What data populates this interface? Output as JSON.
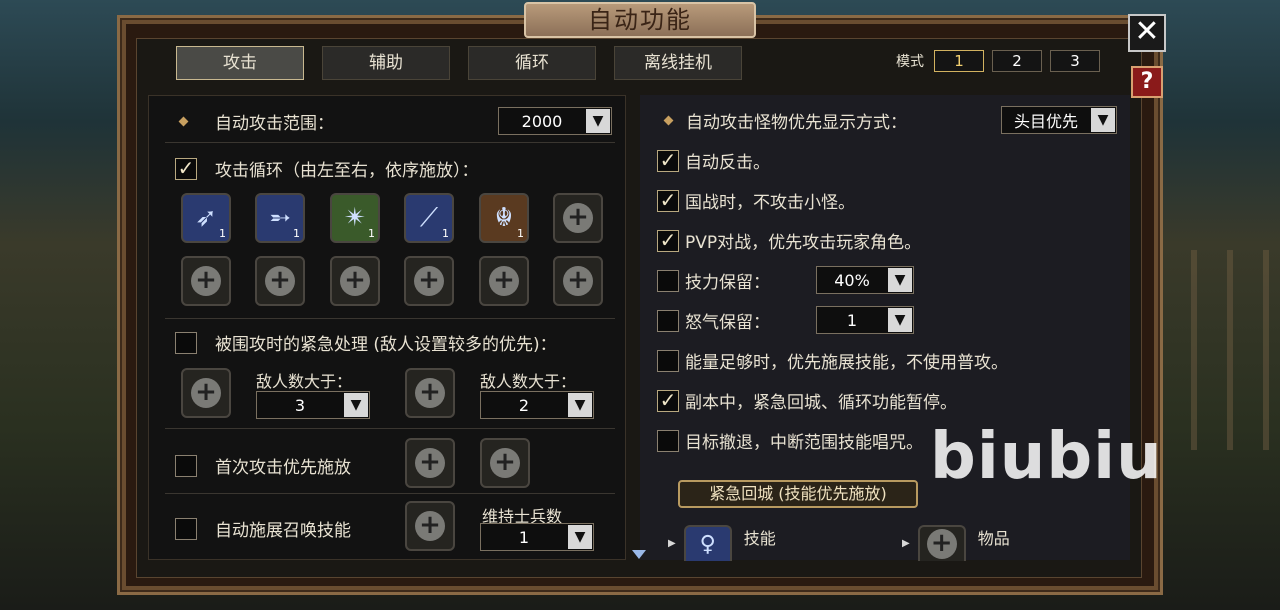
{
  "title": "自动功能",
  "close_icon": "✕",
  "help_icon": "?",
  "tabs": [
    "攻击",
    "辅助",
    "循环",
    "离线挂机"
  ],
  "active_tab": 0,
  "modes": {
    "label": "模式",
    "buttons": [
      "1",
      "2",
      "3"
    ],
    "active": 0
  },
  "left": {
    "range_label": "自动攻击范围：",
    "range_value": "2000",
    "cycle_label": "攻击循环（由左至右，依序施放）：",
    "skill_counts": [
      "1",
      "1",
      "1",
      "1",
      "1"
    ],
    "emergency_label": "被围攻时的紧急处理 (敌人设置较多的优先)：",
    "enemy_label_1": "敌人数大于：",
    "enemy_value_1": "3",
    "enemy_label_2": "敌人数大于：",
    "enemy_value_2": "2",
    "first_attack_label": "首次攻击优先施放",
    "summon_label": "自动施展召唤技能",
    "soldier_label": "维持士兵数",
    "soldier_value": "1"
  },
  "right": {
    "priority_label": "自动攻击怪物优先显示方式：",
    "priority_value": "头目优先",
    "options": [
      {
        "label": "自动反击。",
        "checked": true
      },
      {
        "label": "国战时，不攻击小怪。",
        "checked": true
      },
      {
        "label": "PVP对战，优先攻击玩家角色。",
        "checked": true
      },
      {
        "label": "技力保留：",
        "checked": false,
        "value": "40%"
      },
      {
        "label": "怒气保留：",
        "checked": false,
        "value": "1"
      },
      {
        "label": "能量足够时，优先施展技能，不使用普攻。",
        "checked": false
      },
      {
        "label": "副本中，紧急回城、循环功能暂停。",
        "checked": true
      },
      {
        "label": "目标撤退，中断范围技能唱咒。",
        "checked": false
      }
    ],
    "banner": "紧急回城 (技能优先施放)",
    "skill_label": "技能",
    "item_label": "物品"
  },
  "watermark": "biubiu",
  "colors": {
    "accent_gold": "#d2b260",
    "frame_brown": "#8a6a45",
    "panel_dark": "#121212"
  },
  "icons": [
    "close-icon",
    "help-icon",
    "check-icon",
    "dropdown-arrow-icon",
    "plus-icon"
  ]
}
